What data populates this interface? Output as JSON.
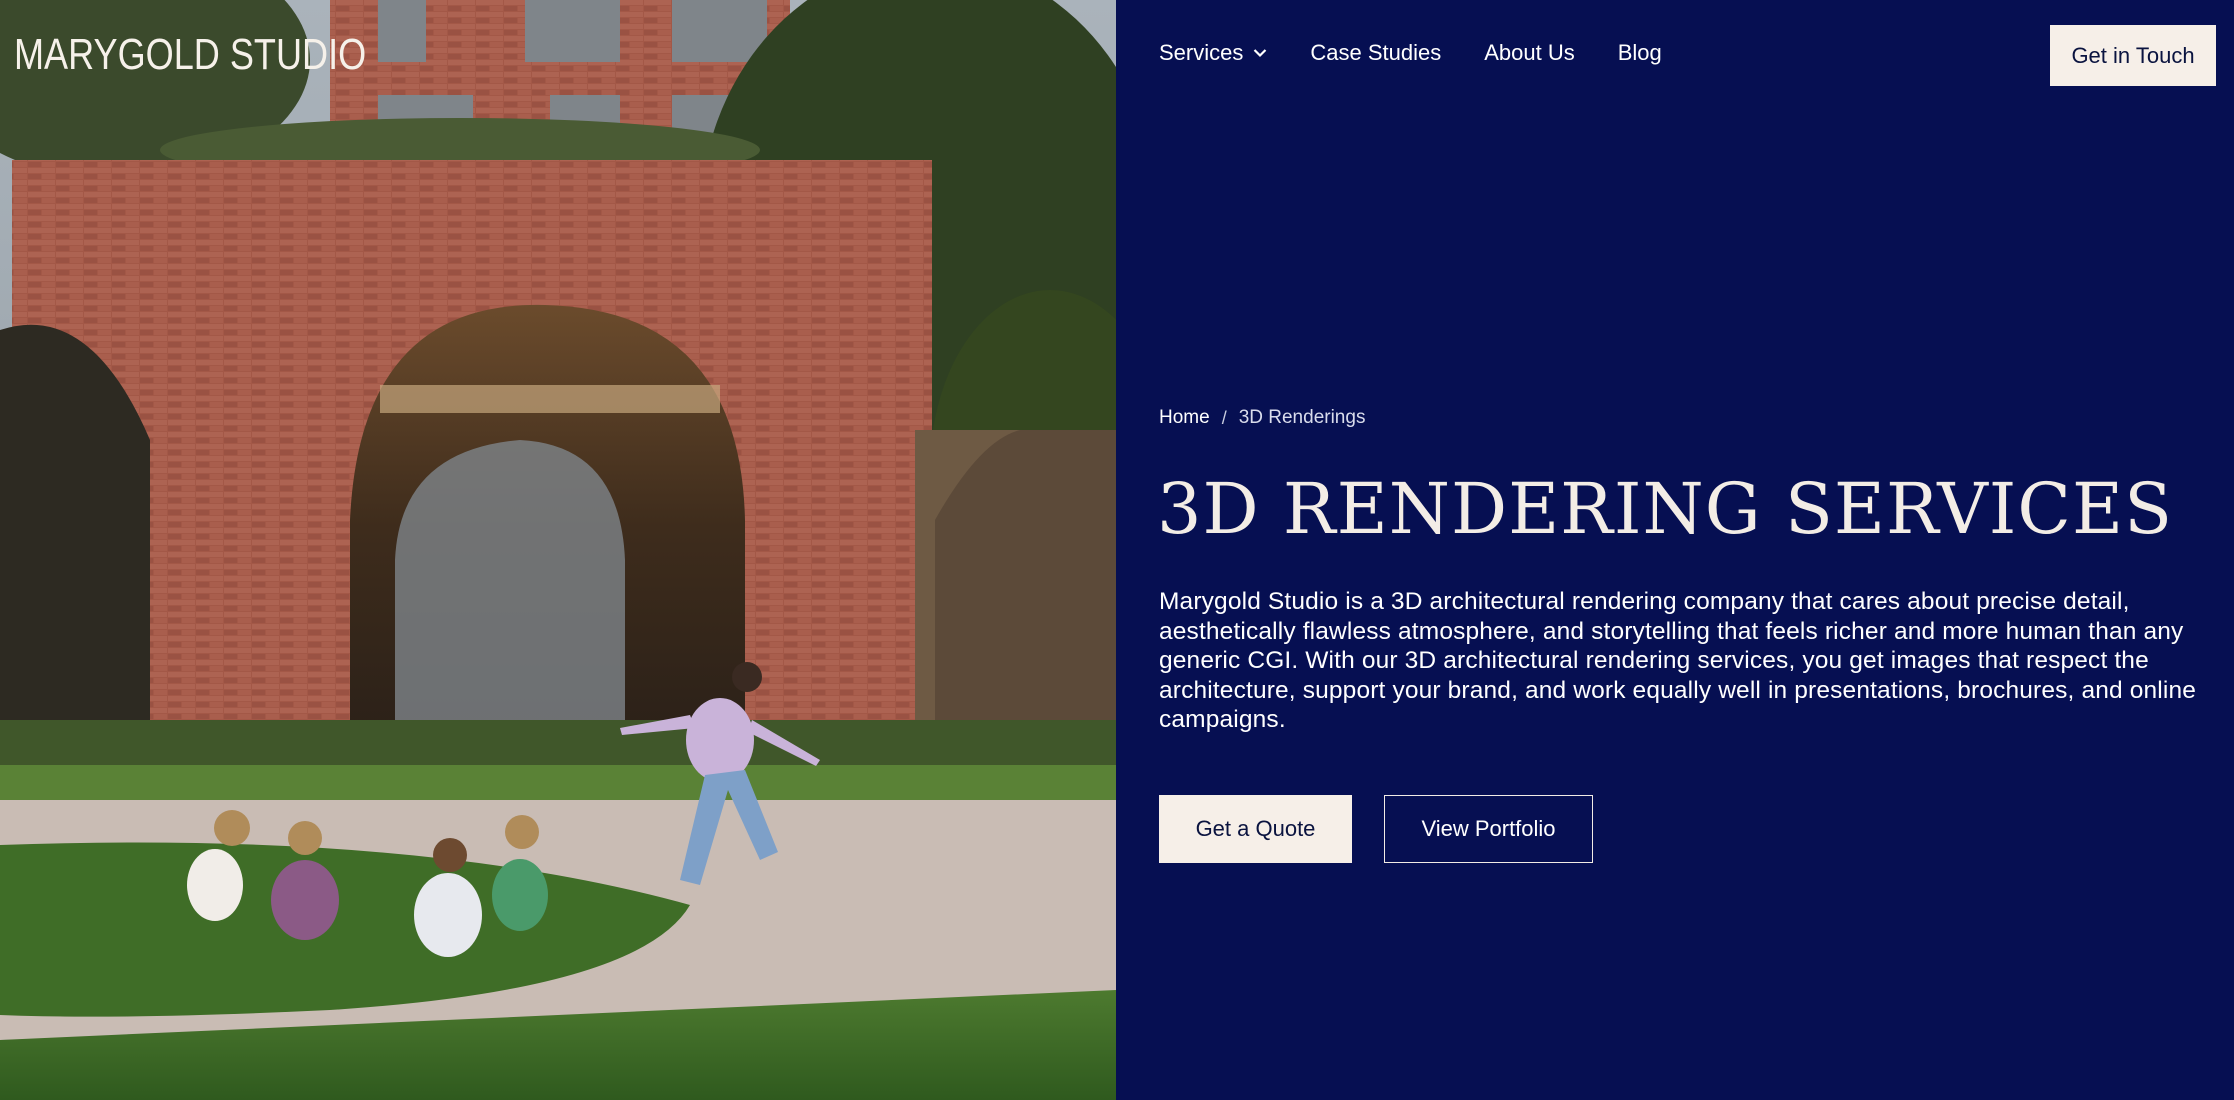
{
  "brand": {
    "logo_text": "MARYGOLD STUDIO"
  },
  "nav": {
    "items": [
      {
        "label": "Services",
        "has_dropdown": true,
        "icon": "chevron-down-icon"
      },
      {
        "label": "Case Studies"
      },
      {
        "label": "About Us"
      },
      {
        "label": "Blog"
      }
    ],
    "cta_label": "Get in Touch"
  },
  "breadcrumb": {
    "home": "Home",
    "separator": "/",
    "current": "3D Renderings"
  },
  "hero": {
    "title": "3D RENDERING SERVICES",
    "intro": "Marygold Studio is a 3D architectural rendering company that cares about precise detail, aesthetically flawless atmosphere, and storytelling that feels richer and more human than any generic CGI. With our 3D architectural rendering services, you get images that respect the architecture, support your brand, and work equally well in presentations, brochures, and online campaigns.",
    "primary_button": "Get a Quote",
    "secondary_button": "View Portfolio"
  },
  "colors": {
    "panel_background": "#060f52",
    "button_light": "#f6efe8",
    "text_light": "#ffffff",
    "brick": "#a4594a"
  }
}
